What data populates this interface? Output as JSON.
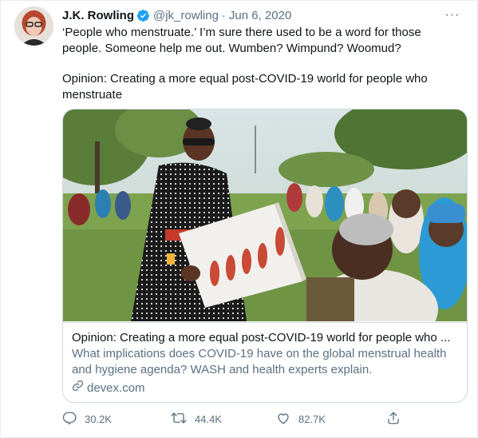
{
  "author": {
    "name": "J.K. Rowling",
    "handle": "@jk_rowling",
    "separator": "·",
    "date": "Jun 6, 2020",
    "avatar_icon": "profile-photo",
    "verified_icon": "verified-badge-icon",
    "verified_color": "#1da1f2"
  },
  "more_icon": "more-dots-icon",
  "more_label": "···",
  "tweet": {
    "text_line_1": "‘People who menstruate.’ I’m sure there used to be a word for those",
    "text_line_2": "people. Someone help me out. Wumben? Wimpund? Woomud?",
    "text_line_3": "Opinion: Creating a more equal post-COVID-19 world for people who",
    "text_line_4": "menstruate"
  },
  "card": {
    "image_icon": "article-photo",
    "title": "Opinion: Creating a more equal post-COVID-19 world for people who ...",
    "description_line_1": "What implications does COVID-19 have on the global menstrual health",
    "description_line_2": "and hygiene agenda? WASH and health experts explain.",
    "domain_icon": "link-icon",
    "domain": "devex.com"
  },
  "actions": {
    "reply": {
      "icon": "reply-icon",
      "count": "30.2K"
    },
    "retweet": {
      "icon": "retweet-icon",
      "count": "44.4K"
    },
    "like": {
      "icon": "heart-icon",
      "count": "82.7K"
    },
    "share": {
      "icon": "share-icon"
    }
  },
  "colors": {
    "text_primary": "#0f1419",
    "text_secondary": "#5b7083",
    "border": "#cfd9de",
    "accent": "#1da1f2"
  }
}
